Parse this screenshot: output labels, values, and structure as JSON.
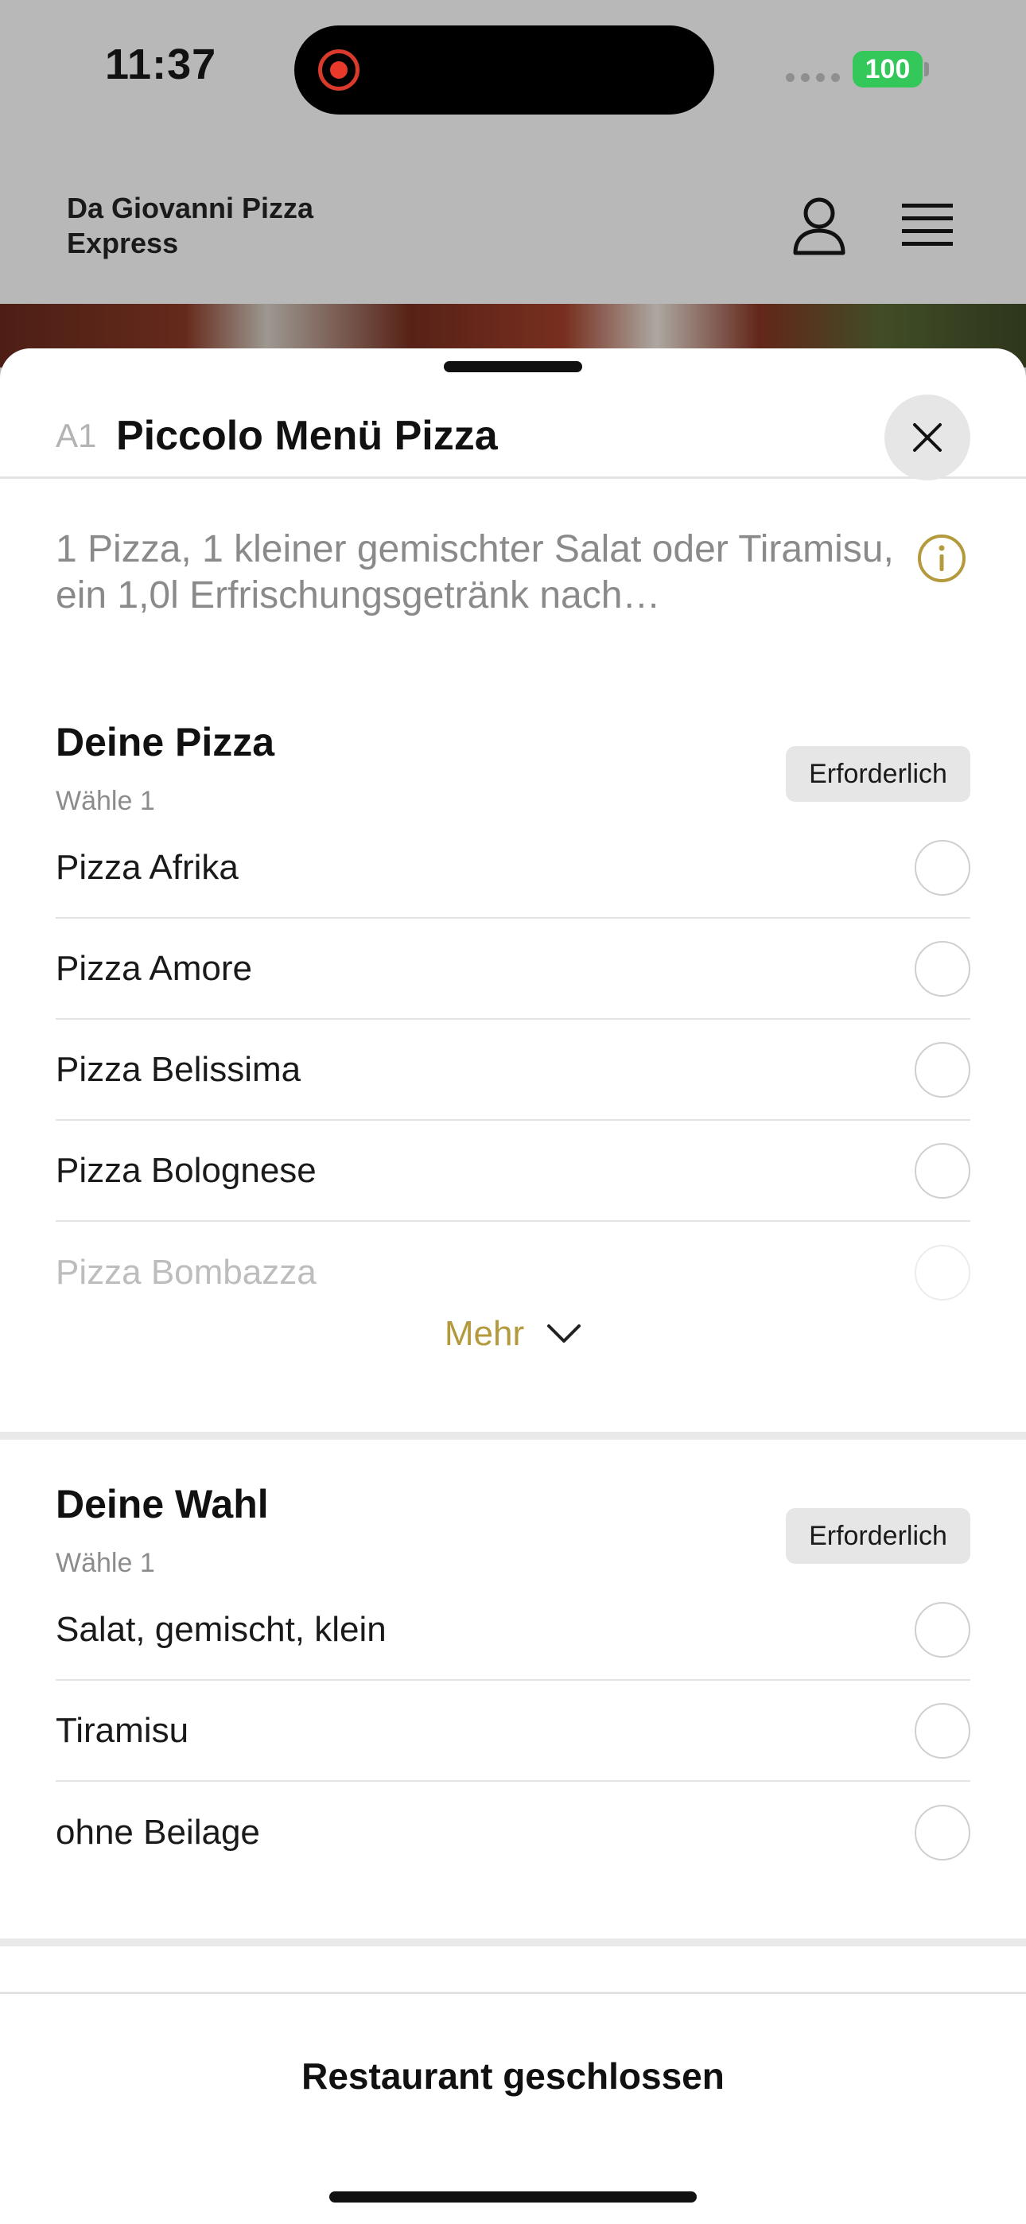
{
  "status_bar": {
    "time": "11:37",
    "battery": "100"
  },
  "header": {
    "restaurant_name": "Da Giovanni Pizza Express",
    "icons": [
      "user-icon",
      "hamburger-menu-icon"
    ]
  },
  "sheet": {
    "item_code": "A1",
    "item_title": "Piccolo Menü Pizza",
    "description": "1 Pizza, 1 kleiner gemischter Salat oder Tiramisu, ein 1,0l Erfrischungsgetränk nach…",
    "accent_color": "#b39a3c"
  },
  "sections": [
    {
      "title": "Deine Pizza",
      "subtitle": "Wähle 1",
      "badge": "Erforderlich",
      "options": [
        "Pizza Afrika",
        "Pizza Amore",
        "Pizza Belissima",
        "Pizza Bolognese",
        "Pizza Bombazza"
      ],
      "more_label": "Mehr"
    },
    {
      "title": "Deine Wahl",
      "subtitle": "Wähle 1",
      "badge": "Erforderlich",
      "options": [
        "Salat, gemischt, klein",
        "Tiramisu",
        "ohne Beilage"
      ]
    }
  ],
  "footer": {
    "status_label": "Restaurant geschlossen"
  }
}
